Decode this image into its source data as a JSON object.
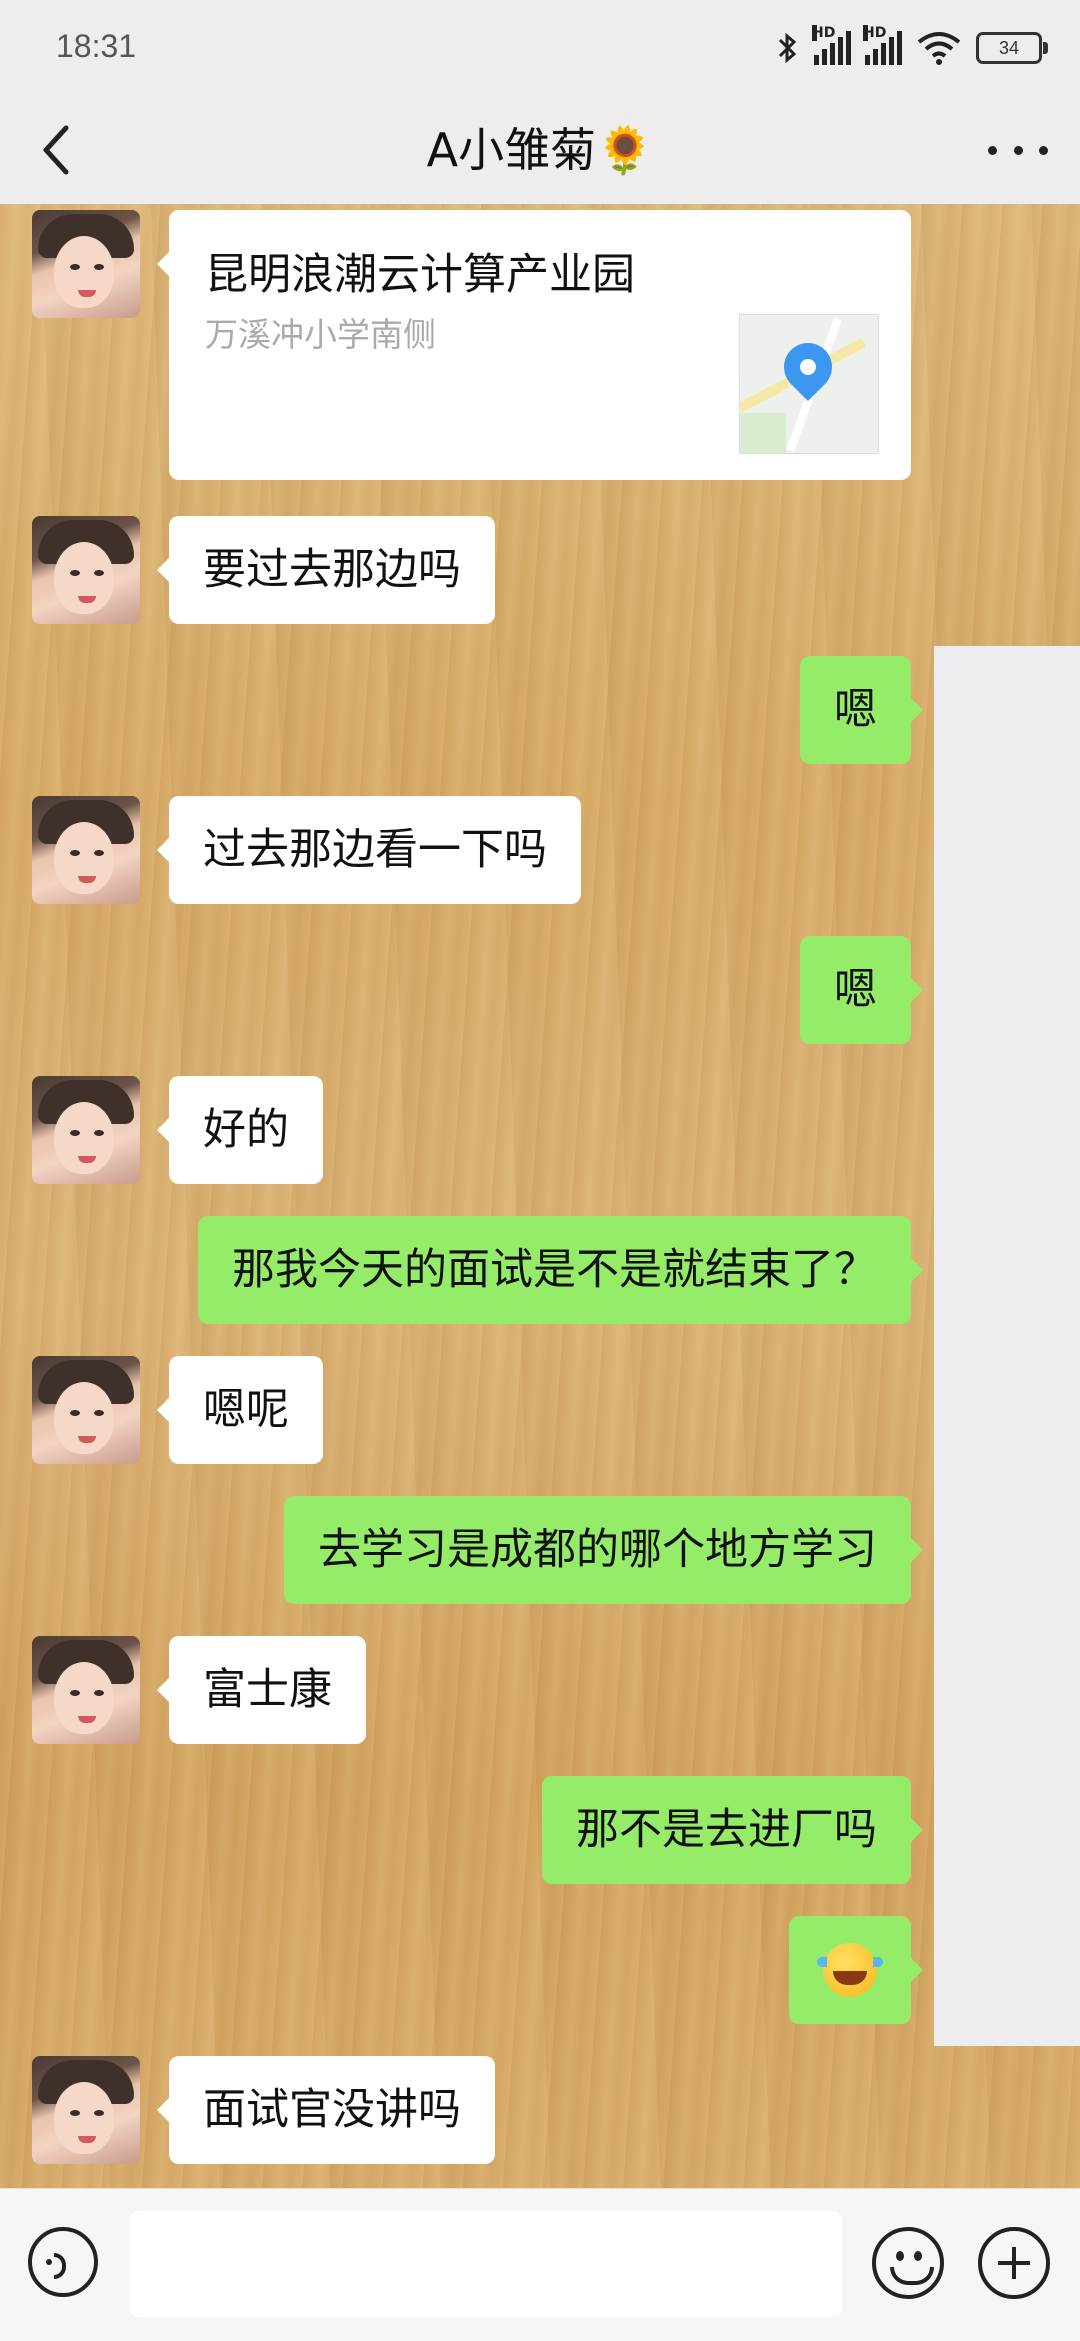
{
  "status_bar": {
    "time": "18:31",
    "battery": "34"
  },
  "header": {
    "title": "A小雏菊🌻"
  },
  "location": {
    "name": "昆明浪潮云计算产业园",
    "address": "万溪冲小学南侧"
  },
  "messages": [
    {
      "from": "them",
      "text": "要过去那边吗"
    },
    {
      "from": "me",
      "text": "嗯"
    },
    {
      "from": "them",
      "text": "过去那边看一下吗"
    },
    {
      "from": "me",
      "text": "嗯"
    },
    {
      "from": "them",
      "text": "好的"
    },
    {
      "from": "me",
      "text": "那我今天的面试是不是就结束了？"
    },
    {
      "from": "them",
      "text": "嗯呢"
    },
    {
      "from": "me",
      "text": "去学习是成都的哪个地方学习"
    },
    {
      "from": "them",
      "text": "富士康"
    },
    {
      "from": "me",
      "text": "那不是去进厂吗"
    },
    {
      "from": "me",
      "emoji": "crying-laughing-emoji"
    },
    {
      "from": "them",
      "text": "面试官没讲吗"
    }
  ],
  "input_bar": {
    "value": ""
  }
}
